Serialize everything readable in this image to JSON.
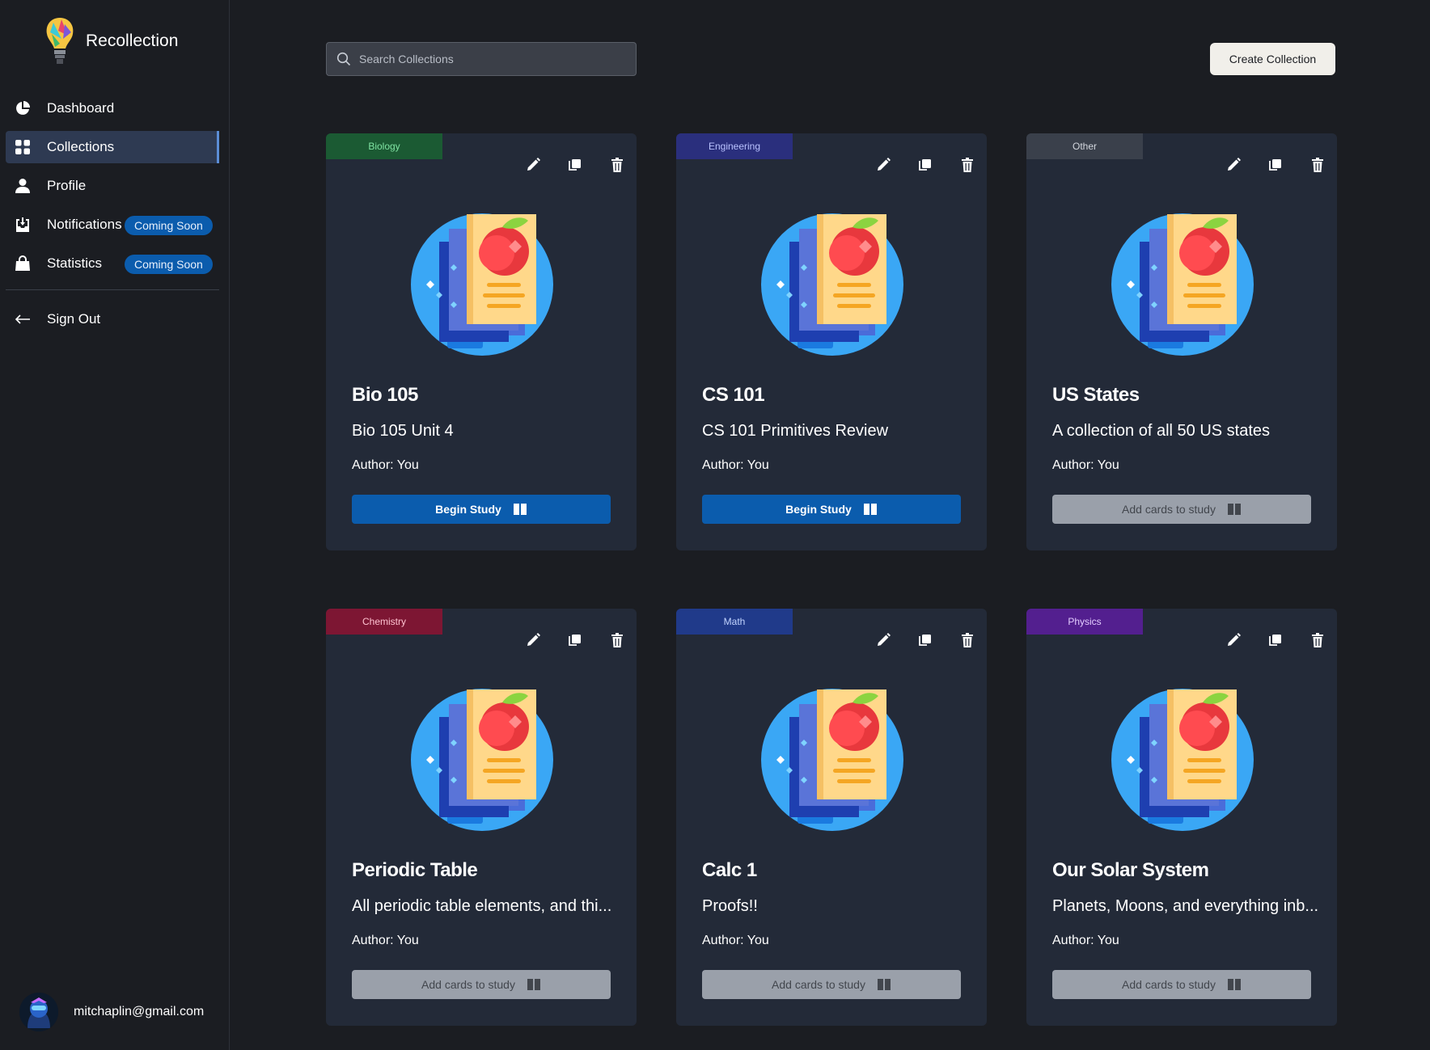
{
  "app": {
    "name": "Recollection"
  },
  "sidebar": {
    "items": [
      {
        "label": "Dashboard",
        "icon": "pie-chart-icon",
        "active": false,
        "badge": ""
      },
      {
        "label": "Collections",
        "icon": "grid-icon",
        "active": true,
        "badge": ""
      },
      {
        "label": "Profile",
        "icon": "user-icon",
        "active": false,
        "badge": ""
      },
      {
        "label": "Notifications",
        "icon": "inbox-icon",
        "active": false,
        "badge": "Coming Soon"
      },
      {
        "label": "Statistics",
        "icon": "bag-icon",
        "active": false,
        "badge": "Coming Soon"
      }
    ],
    "sign_out": "Sign Out",
    "user_email": "mitchaplin@gmail.com"
  },
  "toolbar": {
    "search_placeholder": "Search Collections",
    "create_label": "Create Collection"
  },
  "colors": {
    "accent": "#0b5cad",
    "card_bg": "#232a38",
    "page_bg": "#1b1d22"
  },
  "collections": [
    {
      "tag": "Biology",
      "tag_bg": "#1b5a33",
      "tag_fg": "#7fe3a2",
      "title": "Bio 105",
      "description": "Bio 105 Unit 4",
      "author": "Author: You",
      "study_label": "Begin Study",
      "study_enabled": true
    },
    {
      "tag": "Engineering",
      "tag_bg": "#2a2f7d",
      "tag_fg": "#b9c2ff",
      "title": "CS 101",
      "description": "CS 101 Primitives Review",
      "author": "Author: You",
      "study_label": "Begin Study",
      "study_enabled": true
    },
    {
      "tag": "Other",
      "tag_bg": "#3a404b",
      "tag_fg": "#d3d7de",
      "title": "US States",
      "description": "A collection of all 50 US states",
      "author": "Author: You",
      "study_label": "Add cards to study",
      "study_enabled": false
    },
    {
      "tag": "Chemistry",
      "tag_bg": "#7d1633",
      "tag_fg": "#ffc3d1",
      "title": "Periodic Table",
      "description": "All periodic table elements, and thi...",
      "author": "Author: You",
      "study_label": "Add cards to study",
      "study_enabled": false
    },
    {
      "tag": "Math",
      "tag_bg": "#203a8a",
      "tag_fg": "#c2d4ff",
      "title": "Calc 1",
      "description": "Proofs!!",
      "author": "Author: You",
      "study_label": "Add cards to study",
      "study_enabled": false
    },
    {
      "tag": "Physics",
      "tag_bg": "#531f8f",
      "tag_fg": "#e3cdff",
      "title": "Our Solar System",
      "description": "Planets, Moons, and everything inb...",
      "author": "Author: You",
      "study_label": "Add cards to study",
      "study_enabled": false
    }
  ],
  "card_actions": [
    "edit-icon",
    "copy-icon",
    "trash-icon"
  ]
}
